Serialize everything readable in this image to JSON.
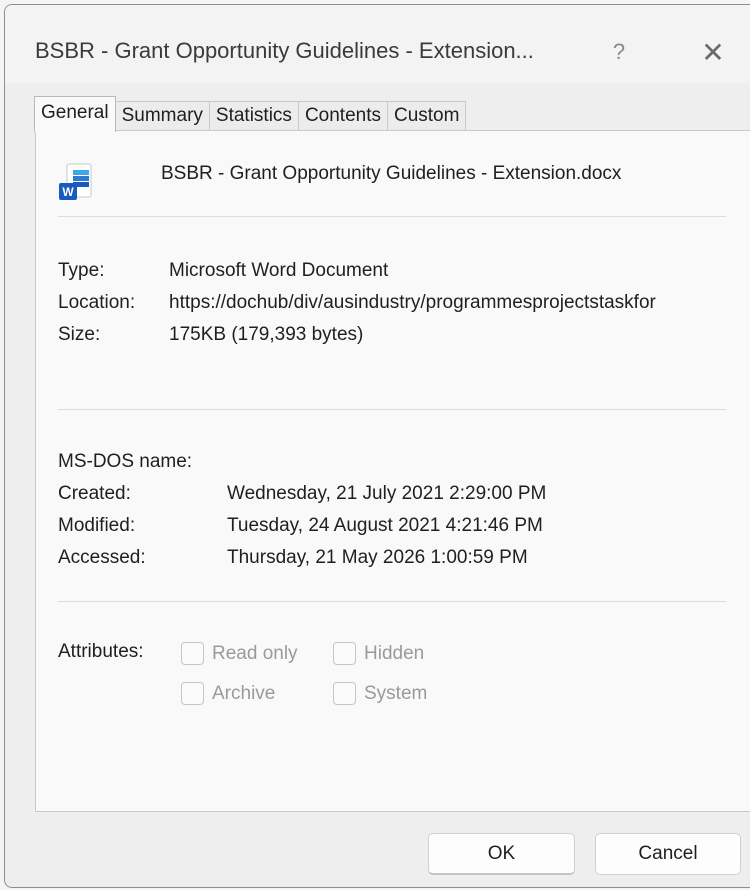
{
  "window": {
    "title": "BSBR - Grant Opportunity Guidelines - Extension...",
    "help_label": "?",
    "close_label": "✕"
  },
  "tabs": [
    {
      "label": "General",
      "active": true
    },
    {
      "label": "Summary",
      "active": false
    },
    {
      "label": "Statistics",
      "active": false
    },
    {
      "label": "Contents",
      "active": false
    },
    {
      "label": "Custom",
      "active": false
    }
  ],
  "file": {
    "icon": "word-document-icon",
    "name": "BSBR - Grant Opportunity Guidelines - Extension.docx"
  },
  "info": {
    "type_label": "Type:",
    "type_value": "Microsoft Word Document",
    "location_label": "Location:",
    "location_value": "https://dochub/div/ausindustry/programmesprojectstaskfor",
    "size_label": "Size:",
    "size_value": "175KB (179,393 bytes)"
  },
  "dates": {
    "msdos_label": "MS-DOS name:",
    "msdos_value": "",
    "created_label": "Created:",
    "created_value": "Wednesday, 21 July 2021 2:29:00 PM",
    "modified_label": "Modified:",
    "modified_value": "Tuesday, 24 August 2021 4:21:46 PM",
    "accessed_label": "Accessed:",
    "accessed_value": "Thursday, 21 May 2026 1:00:59 PM"
  },
  "attributes": {
    "label": "Attributes:",
    "read_only": {
      "label": "Read only",
      "checked": false
    },
    "hidden": {
      "label": "Hidden",
      "checked": false
    },
    "archive": {
      "label": "Archive",
      "checked": false
    },
    "system": {
      "label": "System",
      "checked": false
    }
  },
  "buttons": {
    "ok": "OK",
    "cancel": "Cancel"
  },
  "colors": {
    "word_blue": "#185abd",
    "word_light_blue": "#41a5ee"
  }
}
